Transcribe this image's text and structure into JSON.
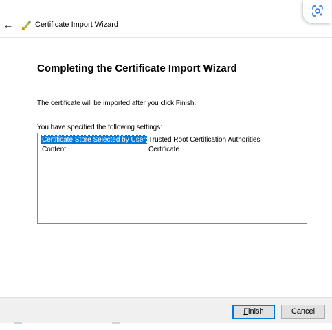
{
  "window": {
    "title": "Certificate Import Wizard",
    "icons": {
      "back": "back-arrow-icon",
      "app": "certificate-wizard-icon",
      "lens": "google-lens-icon"
    }
  },
  "main": {
    "heading": "Completing the Certificate Import Wizard",
    "info": "The certificate will be imported after you click Finish.",
    "settings_label": "You have specified the following settings:",
    "settings": [
      {
        "key": "Certificate Store Selected by User",
        "value": "Trusted Root Certification Authorities"
      },
      {
        "key": "Content",
        "value": "Certificate"
      }
    ]
  },
  "footer": {
    "finish_label": "Finish",
    "cancel_label": "Cancel"
  },
  "colors": {
    "selection": "#0078d7",
    "footer_bg": "#f0f0f0",
    "button_bg": "#e1e1e1"
  }
}
